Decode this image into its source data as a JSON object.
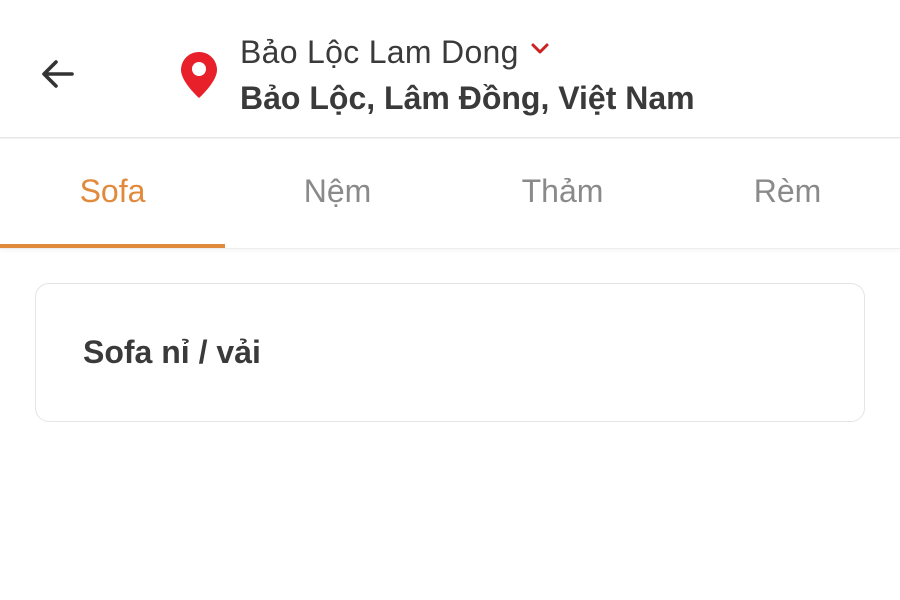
{
  "header": {
    "location_short": "Bảo Lộc Lam Dong",
    "location_full": "Bảo Lộc, Lâm Đồng, Việt Nam",
    "back_icon": "arrow-left-icon",
    "pin_icon": "map-pin-icon",
    "dropdown_icon": "chevron-down-icon",
    "pin_color": "#e8202a",
    "chevron_color": "#cc2222"
  },
  "tabs": [
    {
      "label": "Sofa",
      "active": true
    },
    {
      "label": "Nệm",
      "active": false
    },
    {
      "label": "Thảm",
      "active": false
    },
    {
      "label": "Rèm",
      "active": false
    }
  ],
  "accent_color": "#e28a3c",
  "categories": [
    {
      "label": "Sofa nỉ / vải"
    }
  ]
}
